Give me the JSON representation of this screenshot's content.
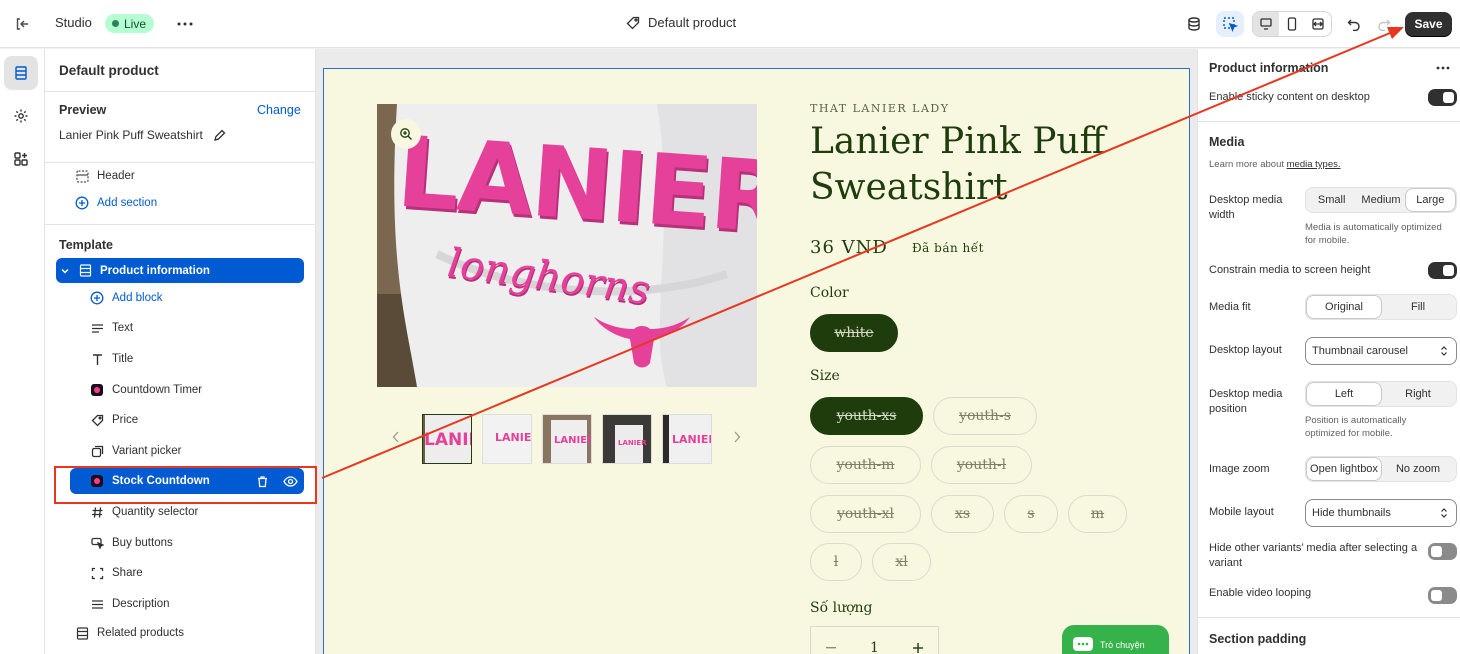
{
  "topbar": {
    "studio": "Studio",
    "live": "Live",
    "page_title": "Default product",
    "save": "Save"
  },
  "sidebar": {
    "title": "Default product",
    "preview_label": "Preview",
    "change": "Change",
    "preview_product": "Lanier Pink Puff Sweatshirt",
    "header": "Header",
    "add_section": "Add section",
    "template": "Template",
    "product_information": "Product information",
    "add_block": "Add block",
    "blocks": [
      "Text",
      "Title",
      "Countdown Timer",
      "Price",
      "Variant picker",
      "Stock Countdown",
      "Quantity selector",
      "Buy buttons",
      "Share",
      "Description"
    ],
    "related_products": "Related products"
  },
  "product": {
    "vendor": "THAT LANIER LADY",
    "title_line1": "Lanier Pink Puff",
    "title_line2": "Sweatshirt",
    "price": "36 VND",
    "sold_out": "Đã bán hết",
    "color_label": "Color",
    "colors": [
      "white"
    ],
    "size_label": "Size",
    "sizes": [
      "youth-xs",
      "youth-s",
      "youth-m",
      "youth-l",
      "youth-xl",
      "xs",
      "s",
      "m",
      "l",
      "xl"
    ],
    "quantity_label": "Số lượng",
    "quantity": "1",
    "chat_label": "Trò chuyện",
    "image_text": "LANIER",
    "image_script": "longhorns"
  },
  "settings": {
    "section_title": "Product information",
    "sticky": "Enable sticky content on desktop",
    "media_heading": "Media",
    "media_help_prefix": "Learn more about ",
    "media_help_link": "media types.",
    "desktop_media_width": "Desktop media width",
    "width_options": [
      "Small",
      "Medium",
      "Large"
    ],
    "width_note": "Media is automatically optimized for mobile.",
    "constrain": "Constrain media to screen height",
    "media_fit": "Media fit",
    "fit_options": [
      "Original",
      "Fill"
    ],
    "desktop_layout": "Desktop layout",
    "desktop_layout_value": "Thumbnail carousel",
    "desktop_media_position": "Desktop media position",
    "position_options": [
      "Left",
      "Right"
    ],
    "position_note": "Position is automatically optimized for mobile.",
    "image_zoom": "Image zoom",
    "zoom_options": [
      "Open lightbox",
      "No zoom"
    ],
    "mobile_layout": "Mobile layout",
    "mobile_layout_value": "Hide thumbnails",
    "hide_variants": "Hide other variants’ media after selecting a variant",
    "video_loop": "Enable video looping",
    "section_padding": "Section padding"
  },
  "colors": {
    "accent": "#005bd3",
    "annotation": "#e8371f",
    "preview_bg": "#f8f8e0",
    "product_green": "#1f3d0c"
  }
}
